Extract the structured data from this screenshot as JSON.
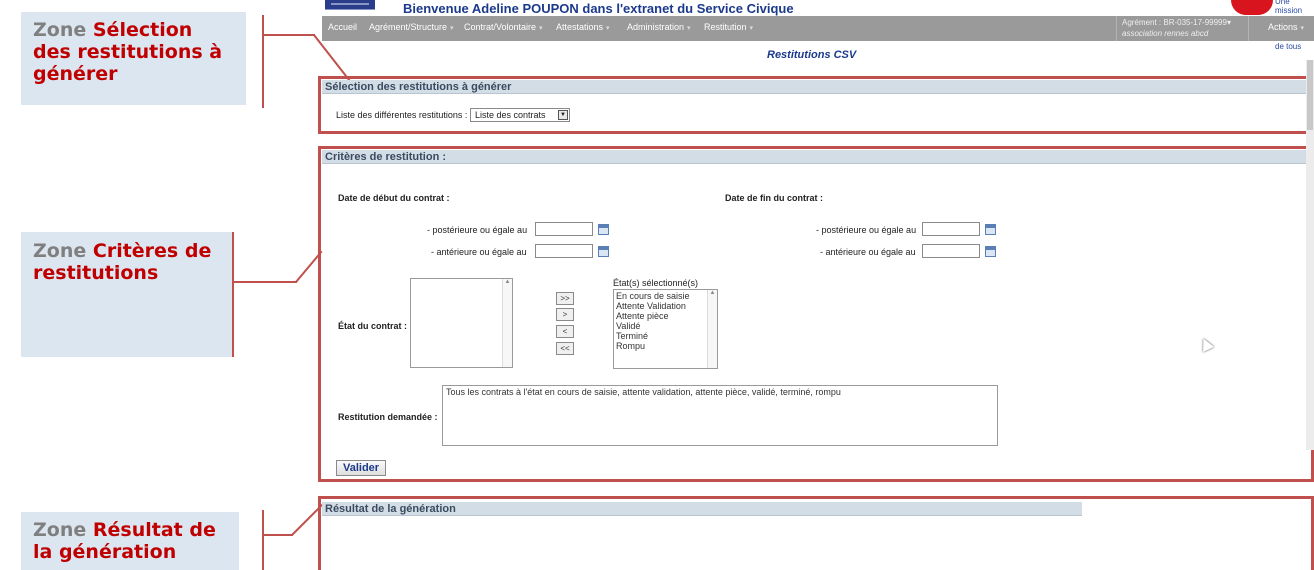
{
  "callouts": [
    {
      "zone_word": "Zone",
      "title": "Sélection des restitutions à générer"
    },
    {
      "zone_word": "Zone",
      "title": "Critères de restitutions"
    },
    {
      "zone_word": "Zone",
      "title": "Résultat de la génération"
    }
  ],
  "header": {
    "welcome": "Bienvenue Adeline POUPON dans l'extranet du Service Civique",
    "tagline_line1": "Une mission pour chacun",
    "tagline_line2": "au service de tous"
  },
  "nav": {
    "items": [
      {
        "label": "Accueil",
        "dropdown": false
      },
      {
        "label": "Agrément/Structure",
        "dropdown": true
      },
      {
        "label": "Contrat/Volontaire",
        "dropdown": true
      },
      {
        "label": "Attestations",
        "dropdown": true
      },
      {
        "label": "Administration",
        "dropdown": true
      },
      {
        "label": "Restitution",
        "dropdown": true
      }
    ],
    "agrement": "Agrément : BR-035-17-99999",
    "association": "association rennes abcd",
    "actions": "Actions",
    "caret": "▾"
  },
  "page_title": "Restitutions CSV",
  "selection": {
    "heading": "Sélection des restitutions à générer",
    "list_label": "Liste des différentes restitutions :",
    "list_value": "Liste des contrats"
  },
  "criteres": {
    "heading": "Critères de restitution :",
    "start_title": "Date de début du contrat :",
    "end_title": "Date de fin du contrat :",
    "after_label": "- postérieure ou égale au",
    "before_label": "- antérieure ou égale au",
    "etat_label": "État du contrat :",
    "selected_title": "État(s) sélectionné(s)",
    "selected_states": [
      "En cours de saisie",
      "Attente Validation",
      "Attente pièce",
      "Validé",
      "Terminé",
      "Rompu"
    ],
    "move_buttons": [
      ">>",
      ">",
      "<",
      "<<"
    ],
    "restitution_label": "Restitution demandée :",
    "restitution_text": "Tous les contrats à l'état en cours de saisie, attente validation, attente pièce, validé, terminé, rompu",
    "valider": "Valider"
  },
  "resultat": {
    "heading": "Résultat de la génération"
  },
  "colors": {
    "accent_red": "#c0504d",
    "callout_bg": "#dce6f1",
    "nav_bg": "#9a9a9a",
    "brand_blue": "#1b3a8c"
  }
}
